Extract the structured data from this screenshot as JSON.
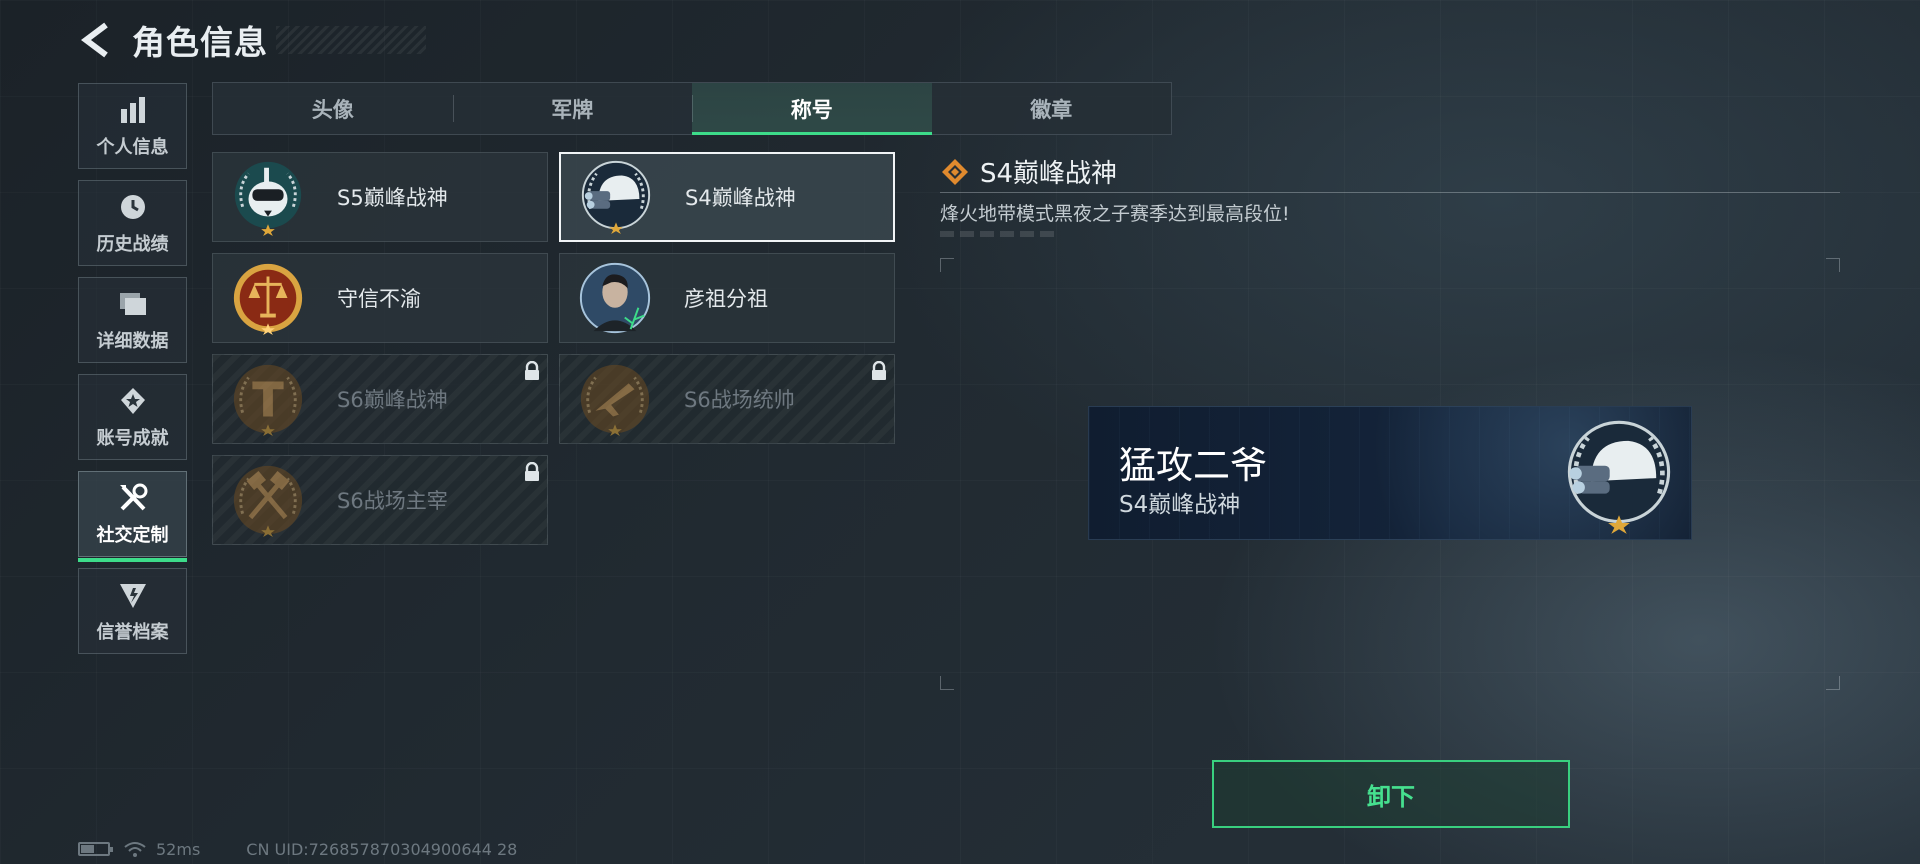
{
  "header": {
    "title": "角色信息"
  },
  "sidebar": {
    "items": [
      {
        "label": "个人信息",
        "icon": "bar-chart-icon"
      },
      {
        "label": "历史战绩",
        "icon": "clock-icon"
      },
      {
        "label": "详细数据",
        "icon": "folder-icon"
      },
      {
        "label": "账号成就",
        "icon": "achievement-icon"
      },
      {
        "label": "社交定制",
        "icon": "tools-icon",
        "active": true
      },
      {
        "label": "信誉档案",
        "icon": "reputation-icon"
      }
    ]
  },
  "tabs": [
    "头像",
    "军牌",
    "称号",
    "徽章"
  ],
  "active_tab": "称号",
  "cards": [
    {
      "name": "S5巅峰战神",
      "emblem": "diver-skull-emblem",
      "locked": false,
      "selected": false
    },
    {
      "name": "S4巅峰战神",
      "emblem": "helmet-nightvision-emblem",
      "locked": false,
      "selected": true
    },
    {
      "name": "守信不渝",
      "emblem": "scales-emblem",
      "locked": false,
      "selected": false
    },
    {
      "name": "彦祖分祖",
      "emblem": "portrait-emblem",
      "locked": false,
      "selected": false
    },
    {
      "name": "S6巅峰战神",
      "emblem": "t-shield-emblem",
      "locked": true,
      "selected": false
    },
    {
      "name": "S6战场统帅",
      "emblem": "jet-emblem",
      "locked": true,
      "selected": false
    },
    {
      "name": "S6战场主宰",
      "emblem": "crossed-hammers-emblem",
      "locked": true,
      "selected": false
    }
  ],
  "detail": {
    "title": "S4巅峰战神",
    "description": "烽火地带模式黑夜之子赛季达到最高段位!"
  },
  "preview": {
    "player_name": "猛攻二爷",
    "title": "S4巅峰战神"
  },
  "unequip_button": "卸下",
  "status": {
    "battery_level": 0.45,
    "ping": "52ms",
    "uid": "CN UID:726857870304900644 28"
  },
  "colors": {
    "accent": "#3ddc8a",
    "background": "#1f282e",
    "gold": "#d9a441",
    "locked_text": "#6e7880"
  }
}
